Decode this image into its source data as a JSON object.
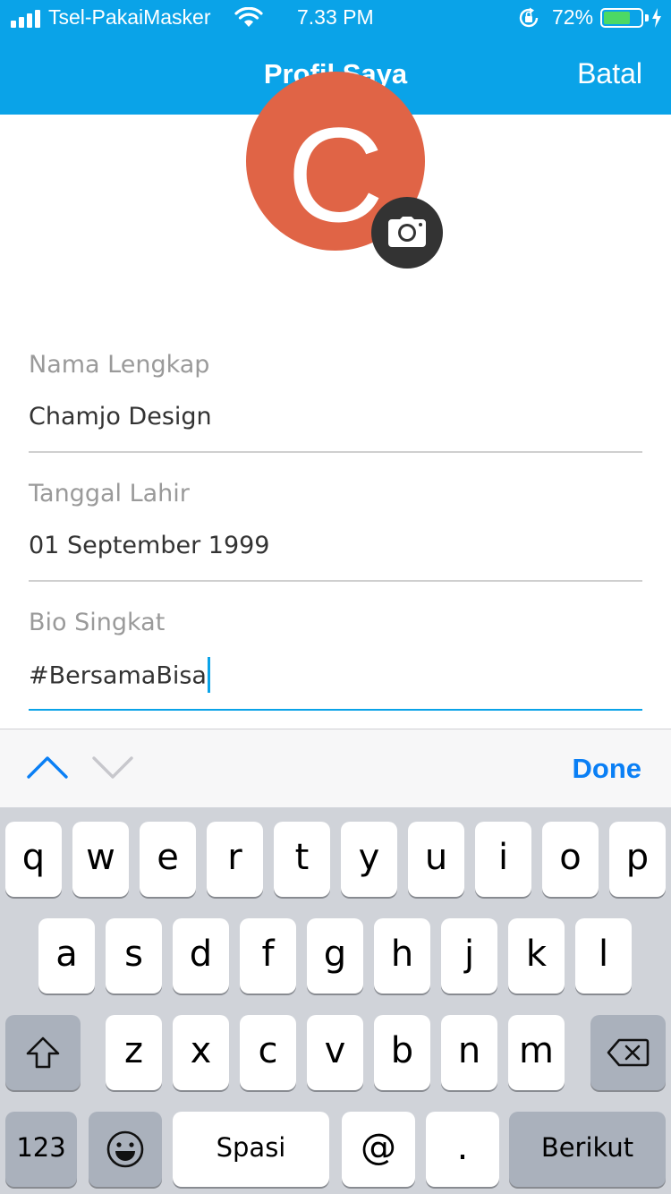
{
  "status_bar": {
    "carrier": "Tsel-PakaiMasker",
    "time": "7.33 PM",
    "battery_percent_text": "72%",
    "battery_level": 0.72,
    "battery_color": "#4cd964",
    "icons": [
      "signal-icon",
      "wifi-icon",
      "orientation-lock-icon",
      "battery-icon",
      "charging-bolt-icon"
    ]
  },
  "nav": {
    "title": "Profil Saya",
    "cancel_label": "Batal",
    "background": "#0aa3e8"
  },
  "profile": {
    "avatar_letter": "C",
    "avatar_color": "#e06446",
    "camera_icon": "camera-icon"
  },
  "form": {
    "fields": [
      {
        "label": "Nama Lengkap",
        "value": "Chamjo Design"
      },
      {
        "label": "Tanggal Lahir",
        "value": "01 September 1999"
      },
      {
        "label": "Bio Singkat",
        "value": "#BersamaBisa",
        "focused": true
      }
    ]
  },
  "accessory": {
    "prev_icon": "chevron-up-icon",
    "next_icon": "chevron-down-icon",
    "done_label": "Done",
    "done_color": "#0a7ff5"
  },
  "keyboard": {
    "row1": [
      "q",
      "w",
      "e",
      "r",
      "t",
      "y",
      "u",
      "i",
      "o",
      "p"
    ],
    "row2": [
      "a",
      "s",
      "d",
      "f",
      "g",
      "h",
      "j",
      "k",
      "l"
    ],
    "row3": [
      "z",
      "x",
      "c",
      "v",
      "b",
      "n",
      "m"
    ],
    "shift_icon": "shift-icon",
    "delete_icon": "backspace-icon",
    "numbers_label": "123",
    "emoji_icon": "emoji-icon",
    "space_label": "Spasi",
    "at_label": "@",
    "dot_label": ".",
    "return_label": "Berikut"
  }
}
